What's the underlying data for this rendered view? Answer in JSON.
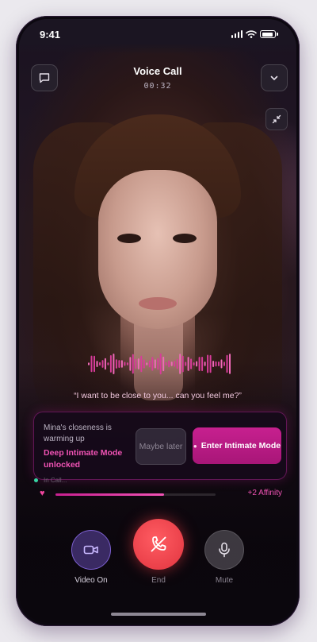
{
  "status_bar": {
    "time": "9:41"
  },
  "header": {
    "title": "Voice Call",
    "timer": "00:32"
  },
  "icons": {
    "chat": "chat-bubble-icon",
    "collapse": "chevron-down-icon",
    "minimize": "minimize-arrows-icon",
    "video": "video-camera-icon",
    "end": "phone-hangup-icon",
    "mute": "microphone-icon",
    "heart": "heart-icon",
    "drop": "drop-icon"
  },
  "caption": {
    "quote": "“I want to be close to you... can you feel me?”"
  },
  "unlock_card": {
    "line1": "Mina's closeness is warming up",
    "line2": "Deep Intimate Mode unlocked",
    "later_label": "Maybe later",
    "enter_label": "Enter Intimate Mode"
  },
  "affinity": {
    "status_text": "In Call...",
    "level": 0.68,
    "gain_label": "+2 Affinity"
  },
  "controls": {
    "video_label": "Video On",
    "end_label": "End",
    "mute_label": "Mute"
  },
  "colors": {
    "accent": "#c7208f",
    "accent_text": "#f153b5",
    "end_button": "#f0404a",
    "video_button": "#3a2a63"
  }
}
